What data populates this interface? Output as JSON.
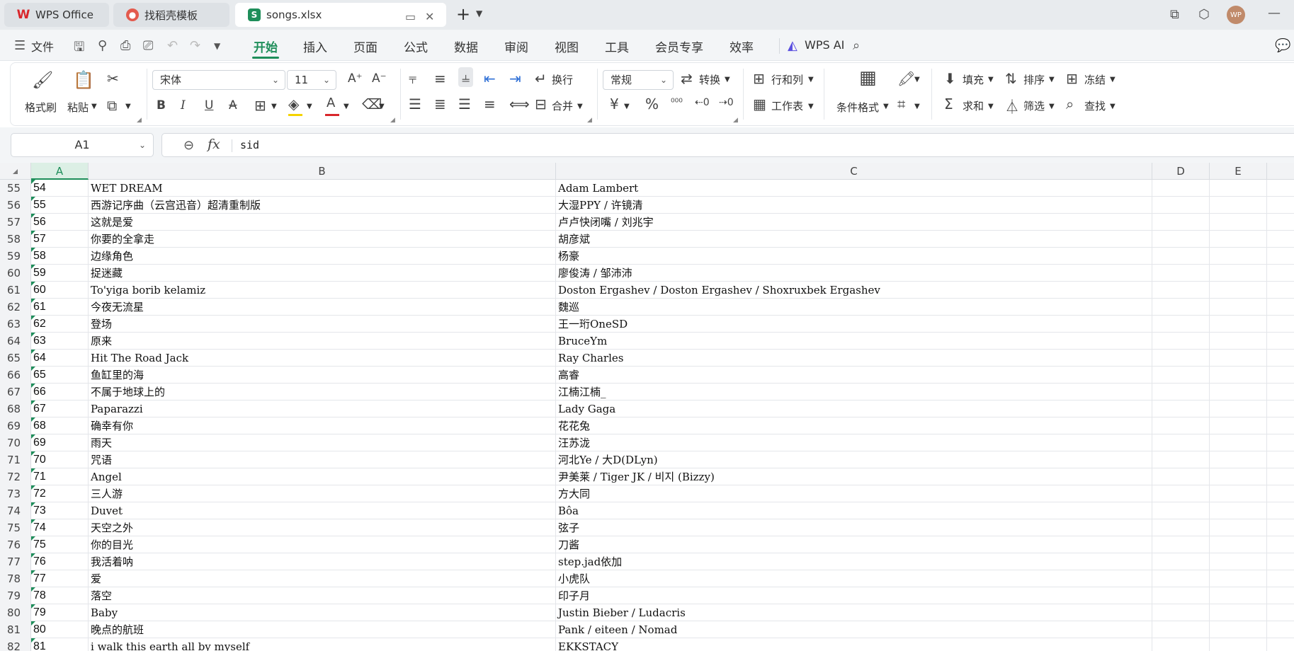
{
  "tabs": [
    {
      "label": "WPS Office",
      "icon": "wps-logo-icon"
    },
    {
      "label": "找稻壳模板",
      "icon": "docer-icon"
    },
    {
      "label": "songs.xlsx",
      "icon": "sheet-icon"
    }
  ],
  "window": {
    "avatar_text": "WP"
  },
  "menu": {
    "file": "文件",
    "tabs": [
      "开始",
      "插入",
      "页面",
      "公式",
      "数据",
      "审阅",
      "视图",
      "工具",
      "会员专享",
      "效率"
    ],
    "active": "开始",
    "ai": "WPS AI"
  },
  "ribbon": {
    "format_painter": "格式刷",
    "paste": "粘贴",
    "font_name": "宋体",
    "font_size": "11",
    "wrap": "换行",
    "merge": "合并",
    "number_format": "常规",
    "convert": "转换",
    "rows_cols": "行和列",
    "worksheet": "工作表",
    "cond_format": "条件格式",
    "fill": "填充",
    "sort": "排序",
    "freeze": "冻结",
    "sum": "求和",
    "filter": "筛选",
    "find": "查找",
    "font_color": "#d9262b",
    "highlight_color": "#f5d300"
  },
  "formula_bar": {
    "cell_ref": "A1",
    "formula": "sid"
  },
  "grid": {
    "columns": [
      "A",
      "B",
      "C",
      "D",
      "E"
    ],
    "selected_column": "A",
    "rows": [
      {
        "rn": "55",
        "a": "54",
        "b": "WET DREAM",
        "c": "Adam Lambert"
      },
      {
        "rn": "56",
        "a": "55",
        "b": "西游记序曲（云宫迅音）超清重制版",
        "c": "大湿PPY / 许镜清"
      },
      {
        "rn": "57",
        "a": "56",
        "b": "这就是爱",
        "c": "卢卢快闭嘴 / 刘兆宇"
      },
      {
        "rn": "58",
        "a": "57",
        "b": "你要的全拿走",
        "c": "胡彦斌"
      },
      {
        "rn": "59",
        "a": "58",
        "b": "边缘角色",
        "c": "杨豪"
      },
      {
        "rn": "60",
        "a": "59",
        "b": "捉迷藏",
        "c": "廖俊涛 / 邹沛沛"
      },
      {
        "rn": "61",
        "a": "60",
        "b": "To'yiga borib kelamiz",
        "c": "Doston Ergashev / Doston Ergashev / Shoxruxbek Ergashev"
      },
      {
        "rn": "62",
        "a": "61",
        "b": "今夜无流星",
        "c": "魏巡"
      },
      {
        "rn": "63",
        "a": "62",
        "b": "登场",
        "c": "王一珩OneSD"
      },
      {
        "rn": "64",
        "a": "63",
        "b": "原来",
        "c": "BruceYm"
      },
      {
        "rn": "65",
        "a": "64",
        "b": "Hit The Road Jack",
        "c": "Ray Charles"
      },
      {
        "rn": "66",
        "a": "65",
        "b": "鱼缸里的海",
        "c": "高睿"
      },
      {
        "rn": "67",
        "a": "66",
        "b": "不属于地球上的",
        "c": "江楠江楠_"
      },
      {
        "rn": "68",
        "a": "67",
        "b": "Paparazzi",
        "c": "Lady Gaga"
      },
      {
        "rn": "69",
        "a": "68",
        "b": "确幸有你",
        "c": "花花兔"
      },
      {
        "rn": "70",
        "a": "69",
        "b": "雨天",
        "c": "汪苏泷"
      },
      {
        "rn": "71",
        "a": "70",
        "b": "咒语",
        "c": "河北Ye / 大D(DLyn)"
      },
      {
        "rn": "72",
        "a": "71",
        "b": "Angel",
        "c": "尹美莱 / Tiger JK / 비지 (Bizzy)"
      },
      {
        "rn": "73",
        "a": "72",
        "b": "三人游",
        "c": "方大同"
      },
      {
        "rn": "74",
        "a": "73",
        "b": "Duvet",
        "c": "Bôa"
      },
      {
        "rn": "75",
        "a": "74",
        "b": "天空之外",
        "c": "弦子"
      },
      {
        "rn": "76",
        "a": "75",
        "b": "你的目光",
        "c": "刀酱"
      },
      {
        "rn": "77",
        "a": "76",
        "b": "我活着呐",
        "c": "step.jad依加"
      },
      {
        "rn": "78",
        "a": "77",
        "b": "爱",
        "c": "小虎队"
      },
      {
        "rn": "79",
        "a": "78",
        "b": "落空",
        "c": "印子月"
      },
      {
        "rn": "80",
        "a": "79",
        "b": "Baby",
        "c": "Justin Bieber / Ludacris"
      },
      {
        "rn": "81",
        "a": "80",
        "b": "晚点的航班",
        "c": "Pank / eiteen / Nomad"
      },
      {
        "rn": "82",
        "a": "81",
        "b": "i walk this earth all by myself",
        "c": "EKKSTACY"
      }
    ]
  }
}
